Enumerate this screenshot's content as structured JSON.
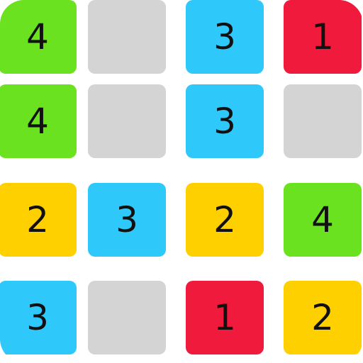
{
  "colors": {
    "green": "#6be21f",
    "blue": "#2ec8fb",
    "red": "#f01a3c",
    "yellow": "#ffd000",
    "empty": "#d4d4d4"
  },
  "grid": {
    "rows": 4,
    "cols": 4,
    "tiles": [
      [
        {
          "value": "4",
          "color": "green"
        },
        {
          "value": "",
          "color": "empty"
        },
        {
          "value": "3",
          "color": "blue"
        },
        {
          "value": "1",
          "color": "red"
        }
      ],
      [
        {
          "value": "4",
          "color": "green"
        },
        {
          "value": "",
          "color": "empty"
        },
        {
          "value": "3",
          "color": "blue"
        },
        {
          "value": "",
          "color": "empty"
        }
      ],
      [
        {
          "value": "2",
          "color": "yellow"
        },
        {
          "value": "3",
          "color": "blue"
        },
        {
          "value": "2",
          "color": "yellow"
        },
        {
          "value": "4",
          "color": "green"
        }
      ],
      [
        {
          "value": "3",
          "color": "blue"
        },
        {
          "value": "",
          "color": "empty"
        },
        {
          "value": "1",
          "color": "red"
        },
        {
          "value": "2",
          "color": "yellow"
        }
      ]
    ]
  }
}
